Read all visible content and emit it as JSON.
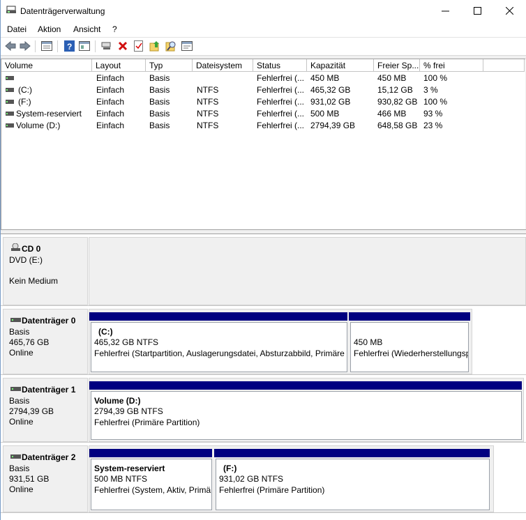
{
  "window": {
    "title": "Datenträgerverwaltung"
  },
  "menu": [
    "Datei",
    "Aktion",
    "Ansicht",
    "?"
  ],
  "toolbar": [
    "back-icon",
    "forward-icon",
    "properties-list-icon",
    "help-icon",
    "console-icon",
    "connect-icon",
    "delete-icon",
    "check-icon",
    "import-icon",
    "search-icon",
    "settings-icon"
  ],
  "columns": [
    "Volume",
    "Layout",
    "Typ",
    "Dateisystem",
    "Status",
    "Kapazität",
    "Freier Sp...",
    "% frei"
  ],
  "volumes": [
    {
      "volume": "",
      "layout": "Einfach",
      "typ": "Basis",
      "fs": "",
      "status": "Fehlerfrei (...",
      "cap": "450 MB",
      "free": "450 MB",
      "pct": "100 %"
    },
    {
      "volume": "(C:)",
      "layout": "Einfach",
      "typ": "Basis",
      "fs": "NTFS",
      "status": "Fehlerfrei (...",
      "cap": "465,32 GB",
      "free": "15,12 GB",
      "pct": "3 %"
    },
    {
      "volume": "(F:)",
      "layout": "Einfach",
      "typ": "Basis",
      "fs": "NTFS",
      "status": "Fehlerfrei (...",
      "cap": "931,02 GB",
      "free": "930,82 GB",
      "pct": "100 %"
    },
    {
      "volume": "System-reserviert",
      "layout": "Einfach",
      "typ": "Basis",
      "fs": "NTFS",
      "status": "Fehlerfrei (...",
      "cap": "500 MB",
      "free": "466 MB",
      "pct": "93 %"
    },
    {
      "volume": "Volume (D:)",
      "layout": "Einfach",
      "typ": "Basis",
      "fs": "NTFS",
      "status": "Fehlerfrei (...",
      "cap": "2794,39 GB",
      "free": "648,58 GB",
      "pct": "23 %"
    }
  ],
  "disks": [
    {
      "name": "CD 0",
      "lines": [
        "DVD (E:)",
        "",
        "Kein Medium"
      ],
      "partitions": []
    },
    {
      "name": "Datenträger 0",
      "lines": [
        "Basis",
        "465,76 GB",
        "Online"
      ],
      "partitions": [
        {
          "title": "(C:)",
          "size": "465,32 GB NTFS",
          "status": "Fehlerfrei (Startpartition, Auslagerungsdatei, Absturzabbild, Primäre"
        },
        {
          "title": "",
          "size": "450 MB",
          "status": "Fehlerfrei (Wiederherstellungsp"
        }
      ]
    },
    {
      "name": "Datenträger 1",
      "lines": [
        "Basis",
        "2794,39 GB",
        "Online"
      ],
      "partitions": [
        {
          "title": "Volume  (D:)",
          "size": "2794,39 GB NTFS",
          "status": "Fehlerfrei (Primäre Partition)"
        }
      ]
    },
    {
      "name": "Datenträger 2",
      "lines": [
        "Basis",
        "931,51 GB",
        "Online"
      ],
      "partitions": [
        {
          "title": "System-reserviert",
          "size": "500 MB NTFS",
          "status": "Fehlerfrei (System, Aktiv, Primä"
        },
        {
          "title": "(F:)",
          "size": "931,02 GB NTFS",
          "status": "Fehlerfrei (Primäre Partition)"
        }
      ]
    }
  ],
  "colors": {
    "partition_bar": "#000080"
  }
}
